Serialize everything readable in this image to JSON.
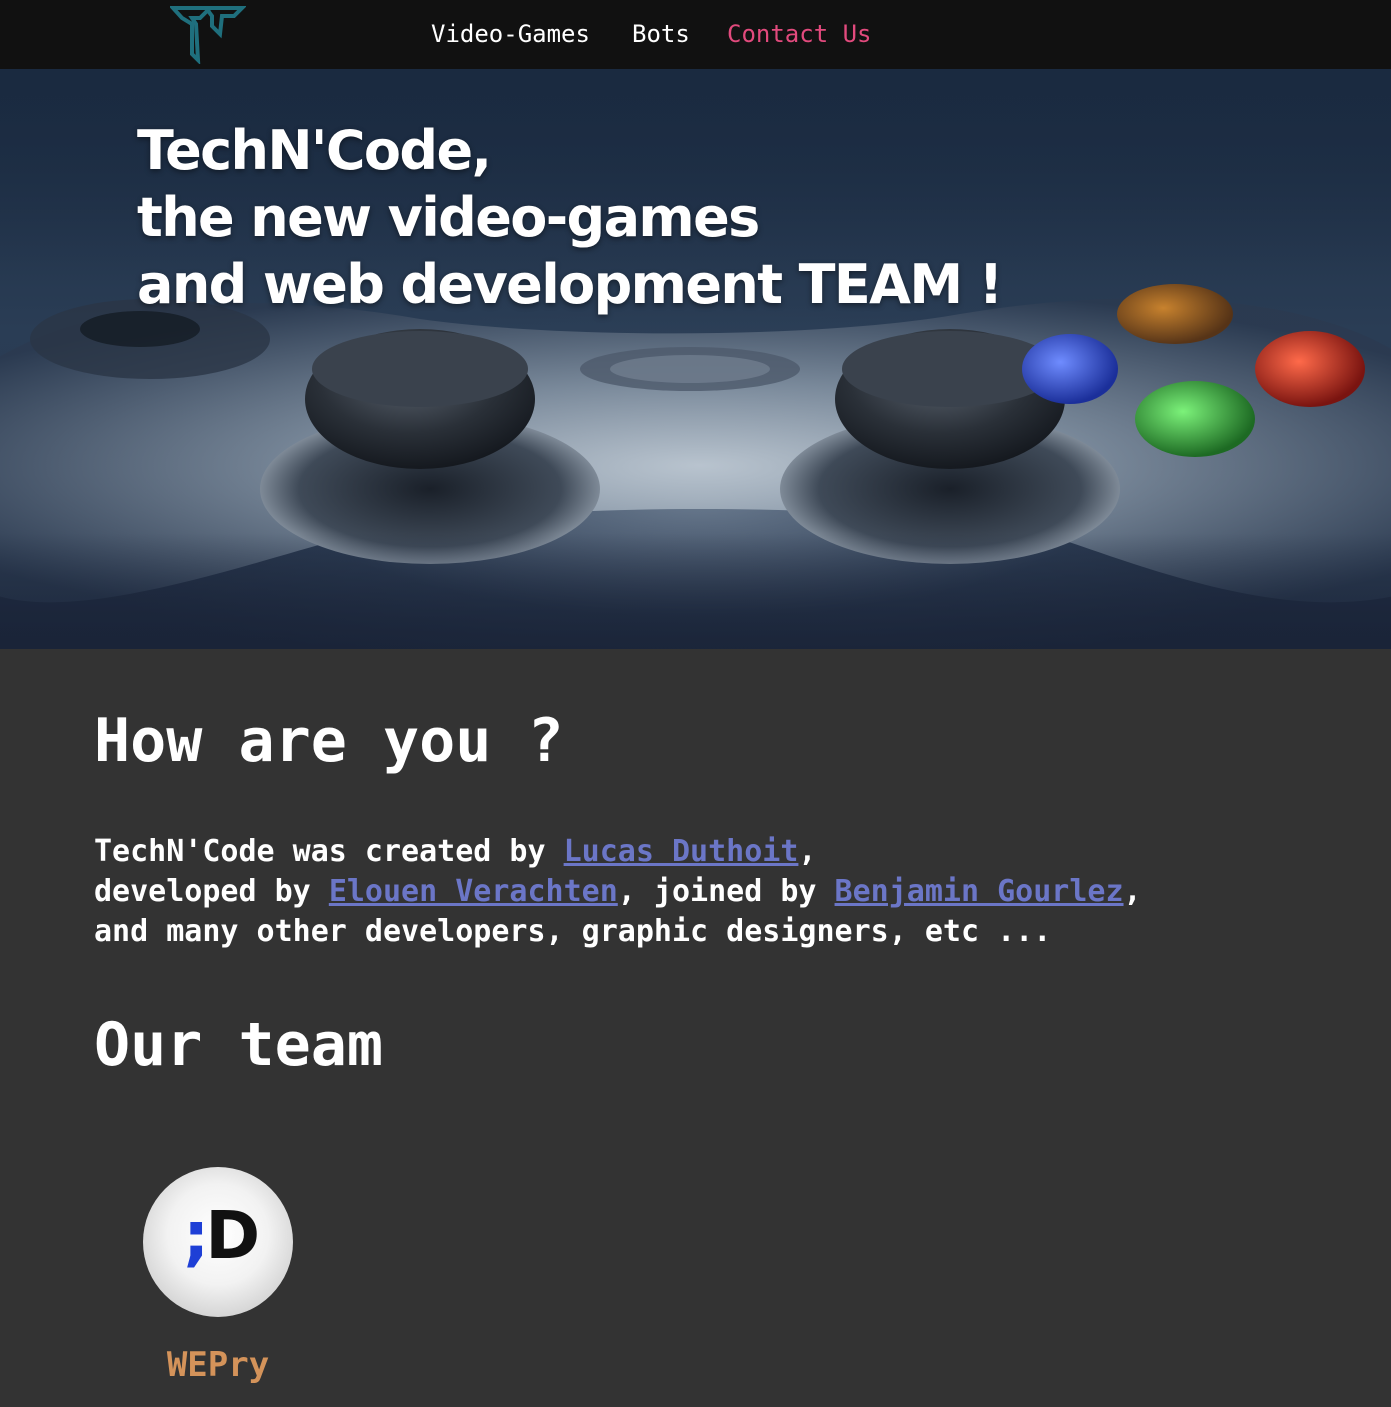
{
  "nav": {
    "logo_icon": "techncode-logo-icon",
    "links": [
      {
        "label": "Video-Games"
      },
      {
        "label": "Bots"
      },
      {
        "label": "Contact Us",
        "color": "#e24a7d"
      }
    ]
  },
  "hero": {
    "title_lines": [
      "TechN'Code,",
      "the new video-games",
      "and web development TEAM !"
    ]
  },
  "about": {
    "heading": "How are you ?",
    "line1_prefix": "TechN'Code was created by ",
    "creator": "Lucas Duthoit",
    "line1_suffix": ",",
    "line2_prefix": "developed by ",
    "developer": "Elouen Verachten",
    "line2_middle": ", joined by ",
    "joiner": "Benjamin Gourlez",
    "line2_suffix": ",",
    "line3": "and many other developers, graphic designers, etc ..."
  },
  "team": {
    "heading": "Our team",
    "members": [
      {
        "avatar_icon": "winking-face-icon",
        "avatar_semicolon": ";",
        "avatar_letter": "D",
        "name": "WEPry",
        "name_color": "#d4935a"
      }
    ]
  },
  "colors": {
    "nav_bg": "#111111",
    "content_bg": "#333333",
    "link": "#6b76c7",
    "contact_accent": "#e24a7d",
    "logo": "#1f6f7d"
  }
}
